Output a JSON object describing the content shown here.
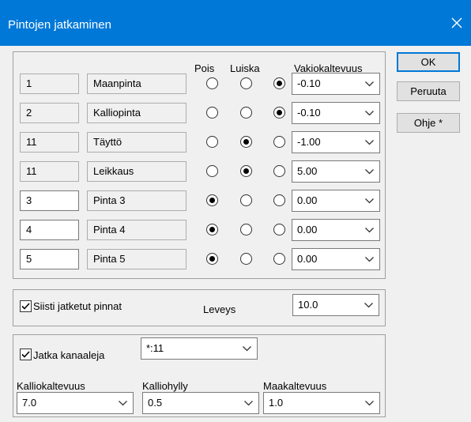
{
  "window": {
    "title": "Pintojen jatkaminen"
  },
  "headers": {
    "pois": "Pois",
    "luiska": "Luiska",
    "vakiokaltevuus": "Vakiokaltevuus"
  },
  "rows": [
    {
      "id": "1",
      "name": "Maanpinta",
      "selected": "vakio",
      "slope": "-0.10",
      "editable": false
    },
    {
      "id": "2",
      "name": "Kalliopinta",
      "selected": "vakio",
      "slope": "-0.10",
      "editable": false
    },
    {
      "id": "11",
      "name": "Täyttö",
      "selected": "luiska",
      "slope": "-1.00",
      "editable": false
    },
    {
      "id": "11",
      "name": "Leikkaus",
      "selected": "luiska",
      "slope": "5.00",
      "editable": false
    },
    {
      "id": "3",
      "name": "Pinta 3",
      "selected": "pois",
      "slope": "0.00",
      "editable": true
    },
    {
      "id": "4",
      "name": "Pinta 4",
      "selected": "pois",
      "slope": "0.00",
      "editable": true
    },
    {
      "id": "5",
      "name": "Pinta 5",
      "selected": "pois",
      "slope": "0.00",
      "editable": true
    }
  ],
  "buttons": {
    "ok": "OK",
    "cancel": "Peruuta",
    "help": "Ohje *"
  },
  "tidy": {
    "checkbox_label": "Siisti jatketut pinnat",
    "checked": true,
    "width_label": "Leveys",
    "width_value": "10.0"
  },
  "channels": {
    "checkbox_label": "Jatka kanaaleja",
    "checked": true,
    "channel_value": "*:11",
    "rock_slope_label": "Kalliokaltevuus",
    "rock_slope_value": "7.0",
    "rock_shelf_label": "Kalliohylly",
    "rock_shelf_value": "0.5",
    "soil_slope_label": "Maakaltevuus",
    "soil_slope_value": "1.0"
  },
  "colors": {
    "titlebar": "#0078d7",
    "dialog_bg": "#f0f0f0",
    "default_button_border": "#0078d7"
  },
  "icons": {
    "close": "close-icon",
    "dropdown": "chevron-down-icon",
    "check": "checkmark-icon"
  }
}
